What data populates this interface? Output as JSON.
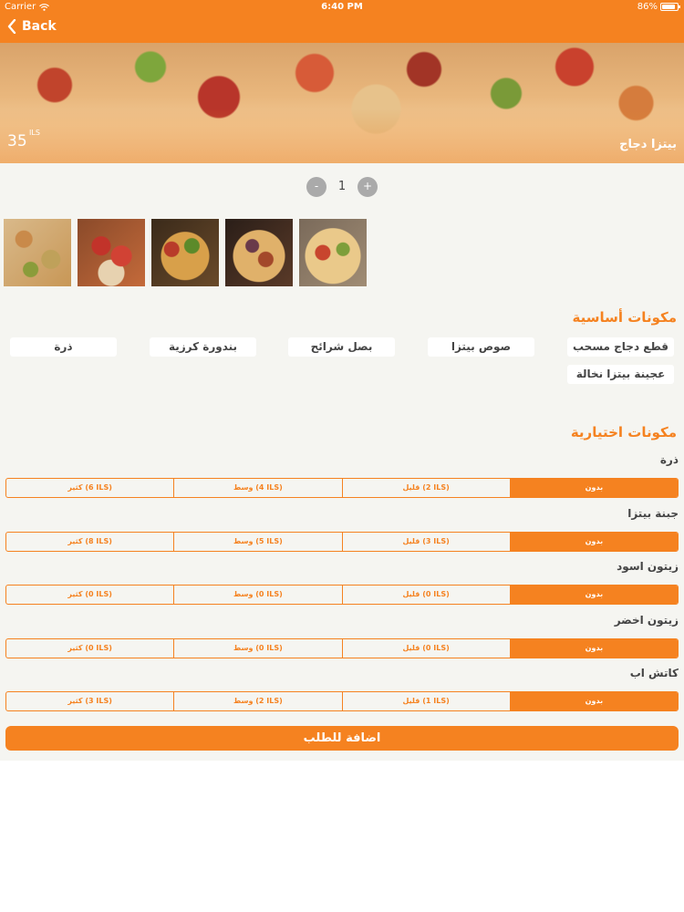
{
  "status_bar": {
    "carrier": "Carrier",
    "time": "6:40 PM",
    "battery": "86%",
    "battery_level": 0.86
  },
  "nav": {
    "back_label": "Back"
  },
  "product": {
    "name": "بيتزا دجاج",
    "price": "35",
    "currency": "ILS"
  },
  "quantity": {
    "value": "1",
    "minus_label": "-",
    "plus_label": "+"
  },
  "basic_ingredients": {
    "title": "مكونات أساسية",
    "items": [
      "قطع دجاج مسحب",
      "صوص بيتزا",
      "بصل شرائح",
      "بندورة كرزية",
      "ذرة",
      "عجينة بيتزا نخالة"
    ]
  },
  "optional_ingredients": {
    "title": "مكونات اختيارية",
    "groups": [
      {
        "name": "ذرة",
        "options": [
          "بدون",
          "قليل (2 ILS)",
          "وسط (4 ILS)",
          "كثير (6 ILS)"
        ],
        "selected": 0
      },
      {
        "name": "جبنة بيتزا",
        "options": [
          "بدون",
          "قليل (3 ILS)",
          "وسط (5 ILS)",
          "كثير (8 ILS)"
        ],
        "selected": 0
      },
      {
        "name": "زيتون اسود",
        "options": [
          "بدون",
          "قليل (0 ILS)",
          "وسط (0 ILS)",
          "كثير (0 ILS)"
        ],
        "selected": 0
      },
      {
        "name": "زيتون اخضر",
        "options": [
          "بدون",
          "قليل (0 ILS)",
          "وسط (0 ILS)",
          "كثير (0 ILS)"
        ],
        "selected": 0
      },
      {
        "name": "كاتش اب",
        "options": [
          "بدون",
          "قليل (1 ILS)",
          "وسط (2 ILS)",
          "كثير (3 ILS)"
        ],
        "selected": 0
      }
    ]
  },
  "add_to_order_label": "اضافة للطلب",
  "colors": {
    "accent": "#f58220",
    "background": "#f5f5f1"
  }
}
